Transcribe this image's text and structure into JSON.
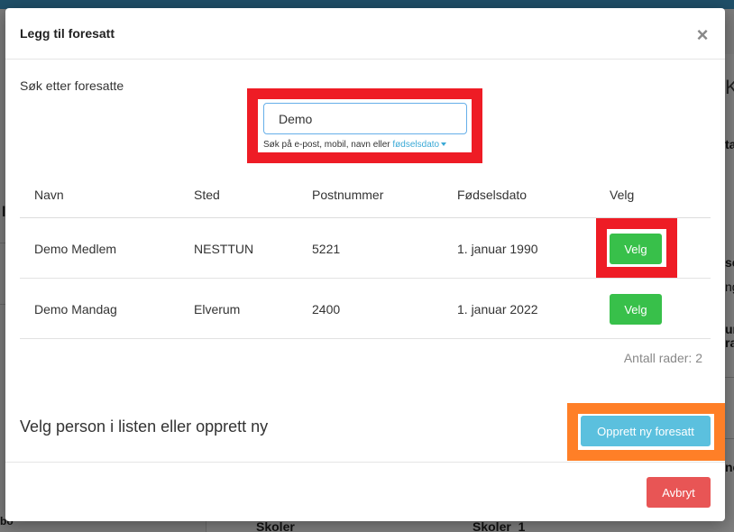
{
  "background": {
    "fragments": [
      "K",
      "ta",
      "se",
      "ng",
      "ur",
      "ra",
      "l",
      "ne",
      "bo",
      "Skoler",
      "Skoler_1"
    ]
  },
  "modal": {
    "title": "Legg til foresatt",
    "close_icon": "×"
  },
  "search": {
    "label": "Søk etter foresatte",
    "value": "Demo",
    "hint_prefix": "Søk på e-post, mobil, navn eller",
    "hint_link": "fødselsdato"
  },
  "table": {
    "headers": [
      "Navn",
      "Sted",
      "Postnummer",
      "Fødselsdato",
      "Velg"
    ],
    "rows": [
      {
        "navn": "Demo Medlem",
        "sted": "NESTTUN",
        "postnummer": "5221",
        "fodselsdato": "1. januar 1990",
        "velg_label": "Velg"
      },
      {
        "navn": "Demo Mandag",
        "sted": "Elverum",
        "postnummer": "2400",
        "fodselsdato": "1. januar 2022",
        "velg_label": "Velg"
      }
    ],
    "row_count": "Antall rader: 2"
  },
  "footer": {
    "instruction": "Velg person i listen eller opprett ny",
    "create_label": "Opprett ny foresatt",
    "cancel_label": "Avbryt"
  },
  "colors": {
    "highlight_red": "#ee1c25",
    "highlight_orange": "#ff7f27",
    "velg_green": "#38c04a",
    "create_blue": "#5bc0de",
    "cancel_red": "#e85555",
    "link_blue": "#3aa9d6"
  }
}
